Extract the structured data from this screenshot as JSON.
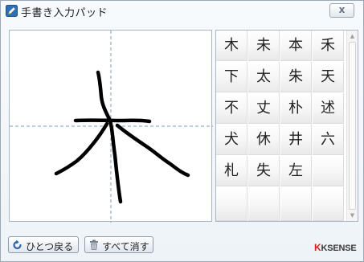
{
  "window": {
    "title": "手書き入力パッド",
    "close_label": "x"
  },
  "candidates": {
    "rows": [
      [
        "木",
        "未",
        "本",
        "禾"
      ],
      [
        "下",
        "太",
        "朱",
        "天"
      ],
      [
        "不",
        "丈",
        "朴",
        "述"
      ],
      [
        "犬",
        "休",
        "井",
        "六"
      ],
      [
        "札",
        "失",
        "左",
        ""
      ],
      [
        "",
        "",
        "",
        ""
      ]
    ]
  },
  "footer": {
    "undo_label": "ひとつ戻る",
    "clear_label": "すべて消す",
    "brand_mark": "K",
    "brand_text": "KSENSE"
  },
  "colors": {
    "guide_line": "#7f9cbd",
    "ink": "#000000",
    "brand_red": "#d42020"
  }
}
